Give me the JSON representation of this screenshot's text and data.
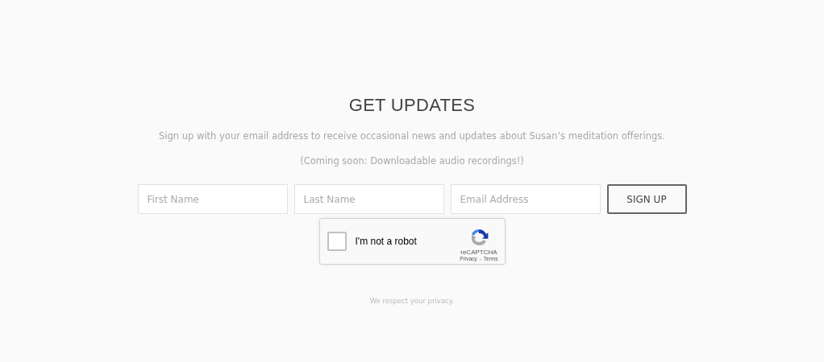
{
  "heading": "GET UPDATES",
  "description": "Sign up with your email address to receive occasional news and updates about Susan’s meditation offerings.",
  "note": "(Coming soon: Downloadable audio recordings!)",
  "fields": [
    {
      "placeholder": "First Name"
    },
    {
      "placeholder": "Last Name"
    },
    {
      "placeholder": "Email Address"
    }
  ],
  "submit_button": "SIGN UP",
  "captcha": {
    "label": "I'm not a robot",
    "checked": false,
    "brand": "reCAPTCHA",
    "privacy_link": "Privacy",
    "separator": "-",
    "terms_link": "Terms"
  },
  "footnote": "We respect your privacy."
}
